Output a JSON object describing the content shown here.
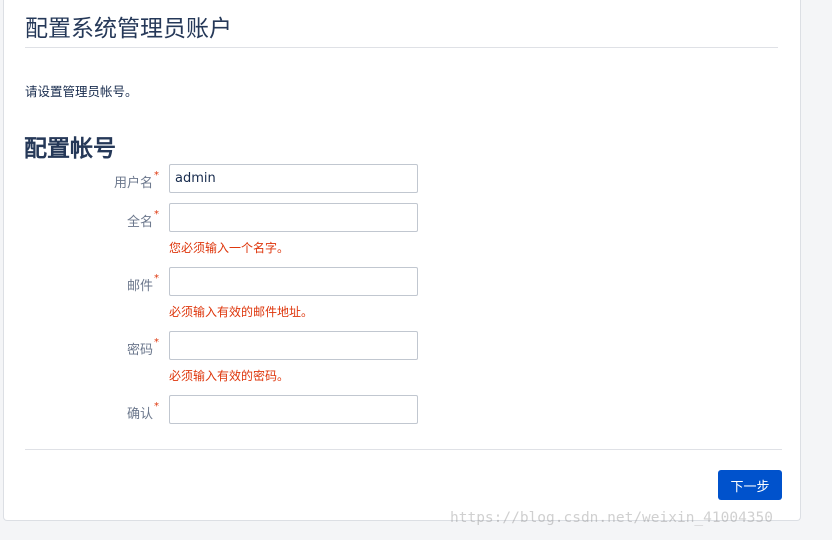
{
  "header": {
    "title": "配置系统管理员账户"
  },
  "intro_text": "请设置管理员帐号。",
  "section": {
    "title": "配置帐号"
  },
  "form": {
    "required_mark": "*",
    "username": {
      "label": "用户名",
      "value": "admin"
    },
    "fullname": {
      "label": "全名",
      "value": "",
      "error": "您必须输入一个名字。"
    },
    "email": {
      "label": "邮件",
      "value": "",
      "error": "必须输入有效的邮件地址。"
    },
    "password": {
      "label": "密码",
      "value": "",
      "error": "必须输入有效的密码。"
    },
    "confirm": {
      "label": "确认",
      "value": ""
    }
  },
  "actions": {
    "next_label": "下一步"
  },
  "watermark": "https://blog.csdn.net/weixin_41004350",
  "colors": {
    "primary_button": "#0052cc",
    "error": "#de350b",
    "title": "#253858"
  }
}
